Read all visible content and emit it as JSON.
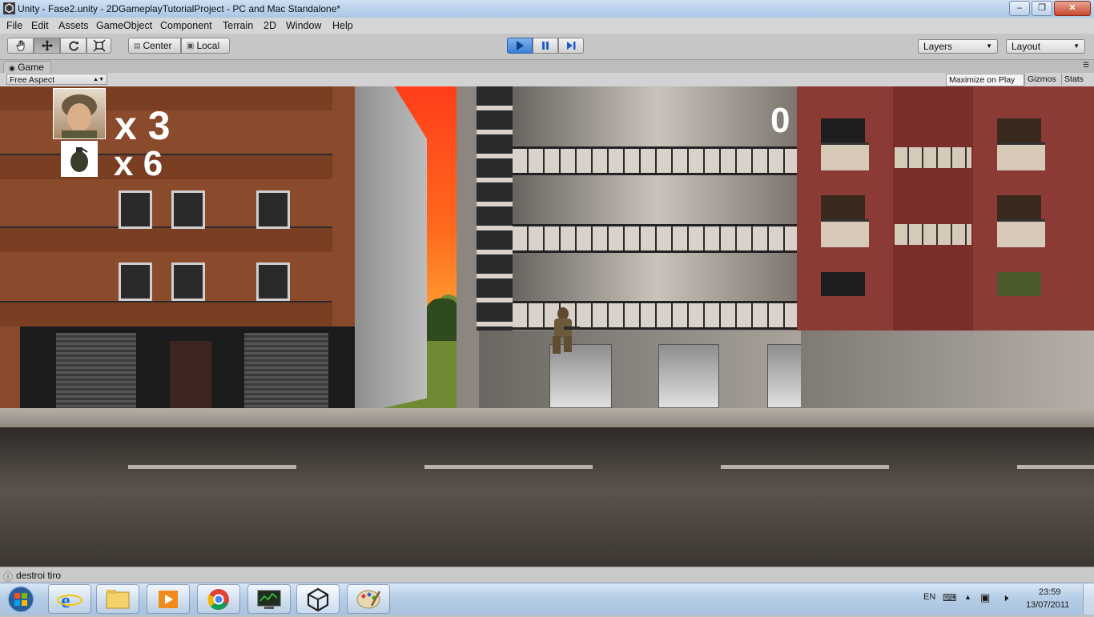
{
  "window": {
    "title": "Unity - Fase2.unity - 2DGameplayTutorialProject - PC and Mac Standalone*"
  },
  "menu": [
    "File",
    "Edit",
    "Assets",
    "GameObject",
    "Component",
    "Terrain",
    "2D",
    "Window",
    "Help"
  ],
  "toolbar": {
    "tools": [
      "hand-tool",
      "move-tool",
      "rotate-tool",
      "scale-tool"
    ],
    "pivot_label": "Center",
    "space_label": "Local",
    "layers_label": "Layers",
    "layout_label": "Layout"
  },
  "game": {
    "tab_label": "Game",
    "aspect": "Free Aspect",
    "maximize_label": "Maximize on Play",
    "gizmos_label": "Gizmos",
    "stats_label": "Stats"
  },
  "hud": {
    "lives": "x 3",
    "grenades": "x 6",
    "score": "0"
  },
  "status": {
    "message": "destroi tiro"
  },
  "taskbar": {
    "apps": [
      "internet-explorer",
      "file-explorer",
      "media-player",
      "chrome",
      "system-monitor",
      "unity",
      "paint"
    ],
    "lang": "EN",
    "time": "23:59",
    "date": "13/07/2011"
  },
  "colors": {
    "accent_play": "#3a7fd8",
    "sky_top": "#ff3d1a",
    "brick": "#8a4a2c",
    "red_building": "#8b3a36"
  }
}
